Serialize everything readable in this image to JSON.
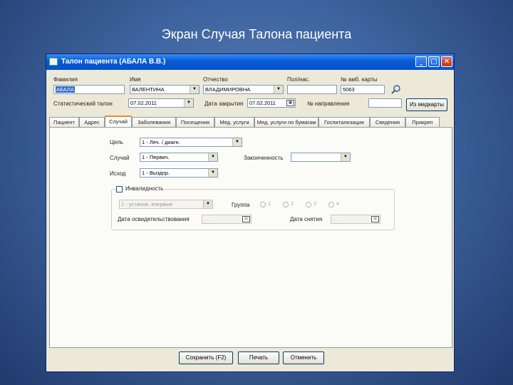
{
  "slide": {
    "title": "Экран Случая Талона пациента"
  },
  "window": {
    "title": "Талон пациента (АБАЛА В.В.)",
    "controls": {
      "minimize": "_",
      "maximize": "□",
      "close": "✕"
    }
  },
  "header": {
    "surname_label": "Фамилия",
    "surname_value": "АБАЛА",
    "name_label": "Имя",
    "name_value": "ВАЛЕНТИНА",
    "patronymic_label": "Отчество",
    "patronymic_value": "ВЛАДИМИРОВНА",
    "gender_label": "Пол/нас.",
    "card_label": "№ амб. карты",
    "card_value": "5063",
    "stat_coupon_label": "Статистический талон",
    "stat_coupon_date": "07.02.2011",
    "closing_date_label": "Дата закрытия",
    "closing_date_value": "07.02.2011",
    "referral_label": "№ направления",
    "medical_button": "Из медкарты"
  },
  "tabs": [
    "Пациент",
    "Адрес",
    "Случай",
    "Заболевания",
    "Посещения",
    "Мед. услуги",
    "Мед. услуги по бумагам",
    "Госпитализация",
    "Сведения",
    "Прикреп"
  ],
  "active_tab": "Случай",
  "case": {
    "purpose_label": "Цель",
    "purpose_value": "1 - Леч. / диагн.",
    "case_label": "Случай",
    "case_value": "1 - Первич.",
    "result_label": "Исход",
    "result_value": "1 - Выздор.",
    "completeness_label": "Законченность"
  },
  "disability": {
    "checkbox_label": "Инвалидность",
    "type_value": "1 - установ. впервые",
    "group_label": "Группа",
    "groups": [
      "1",
      "2",
      "3",
      "4"
    ],
    "date_set_label": "Дата освидетельствования",
    "date_removed_label": "Дата снятия",
    "date_placeholder": ". . ."
  },
  "buttons": {
    "save": "Сохранить (F2)",
    "print": "Печать",
    "cancel": "Отменить"
  }
}
